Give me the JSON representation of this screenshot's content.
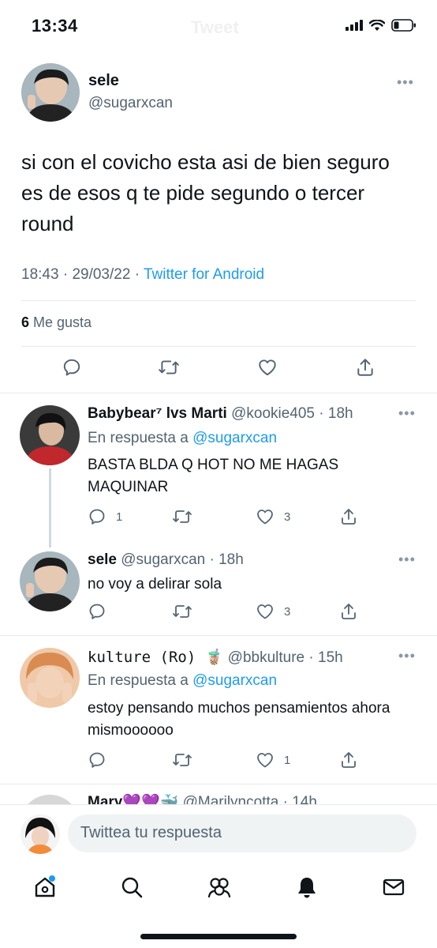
{
  "status_bar": {
    "time": "13:34",
    "ghost_title": "Tweet"
  },
  "main_tweet": {
    "name": "sele",
    "handle": "@sugarxcan",
    "text": "si con el covicho esta asi de bien seguro es de esos q te pide segundo o tercer round",
    "time": "18:43",
    "date": "29/03/22",
    "source": "Twitter for Android",
    "likes_count": "6",
    "likes_label": "Me gusta"
  },
  "replies": [
    {
      "name": "Babybear⁷ lvs Marti",
      "handle": "@kookie405",
      "time": "18h",
      "reply_prefix": "En respuesta a",
      "reply_to": "@sugarxcan",
      "text": "BASTA BLDA Q HOT NO ME HAGAS MAQUINAR",
      "reply_count": "1",
      "like_count": "3"
    },
    {
      "name": "sele",
      "handle": "@sugarxcan",
      "time": "18h",
      "text": "no voy a delirar sola",
      "like_count": "3"
    },
    {
      "name": "𝚔𝚞𝚕𝚝𝚞𝚛𝚎 (Ro) 🧋",
      "handle": "@bbkulture",
      "time": "15h",
      "reply_prefix": "En respuesta a",
      "reply_to": "@sugarxcan",
      "text": "estoy pensando muchos pensamientos ahora mismoooooo",
      "like_count": "1"
    },
    {
      "name": "Mary💜💜🐳",
      "handle": "@Marilyncotta",
      "time": "14h"
    }
  ],
  "compose": {
    "placeholder": "Twittea tu respuesta"
  },
  "icons": {
    "reply": "reply-icon",
    "retweet": "retweet-icon",
    "like": "heart-icon",
    "share": "share-icon",
    "home": "home-icon",
    "search": "search-icon",
    "communities": "communities-icon",
    "notifications": "bell-icon",
    "messages": "mail-icon"
  },
  "colors": {
    "accent": "#1d9bf0",
    "text": "#0f1419",
    "secondary": "#536471"
  }
}
